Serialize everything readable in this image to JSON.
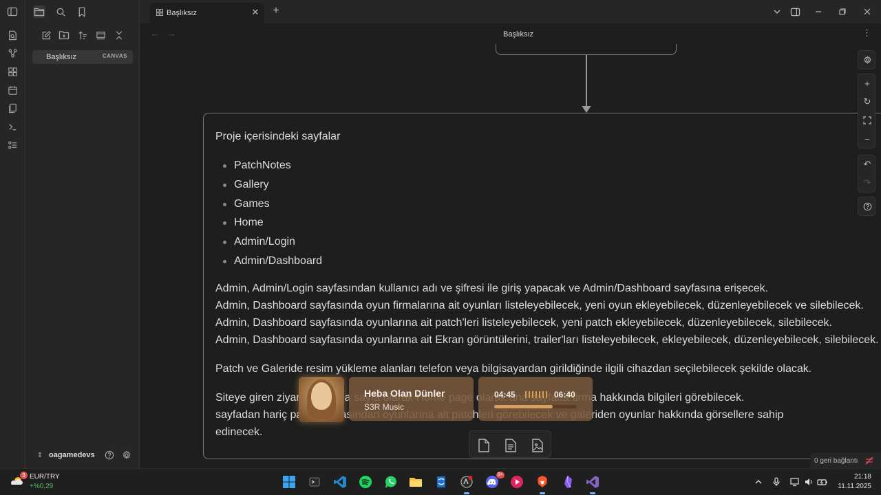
{
  "sidebar": {
    "file": {
      "name": "Başlıksız",
      "badge": "CANVAS"
    },
    "vault_name": "oagamedevs"
  },
  "tabs": [
    {
      "label": "Başlıksız"
    }
  ],
  "view": {
    "title": "Başlıksız"
  },
  "canvas": {
    "node": {
      "heading": "Proje içerisindeki sayfalar",
      "pages": [
        "PatchNotes",
        "Gallery",
        "Games",
        "Home",
        "Admin/Login",
        "Admin/Dashboard"
      ],
      "admin_lines": [
        "Admin, Admin/Login sayfasından kullanıcı adı ve şifresi ile giriş yapacak ve Admin/Dashboard sayfasına erişecek.",
        "Admin, Dashboard sayfasında oyun firmalarına ait oyunları listeleyebilecek, yeni oyun ekleyebilecek, düzenleyebilecek ve silebilecek.",
        "Admin, Dashboard sayfasında oyunlarına ait patch'leri listeleyebilecek, yeni patch ekleyebilecek, düzenleyebilecek, silebilecek.",
        "Admin, Dashboard sayfasında oyunlarına ait Ekran görüntülerini, trailer'ları listeleyebilecek, ekleyebilecek, düzenleyebilecek, silebilecek."
      ],
      "upload_line": "Patch ve Galeride resim yükleme alanları telefon veya bilgisayardan girildiğinde ilgili cihazdan seçilebilecek şekilde olacak.",
      "visitor_lines": [
        "Siteye giren ziyaretçiler ana sayfa olarak Home page olarak ana sayfada firma hakkında bilgileri görebilecek.",
        "sayfadan hariç patch sayfasından oyunlarına ait patchleri görebilecek ve galeriden oyunlar hakkında görsellere sahip",
        "edinecek."
      ]
    }
  },
  "status": {
    "sync": "0 geri bağlantı"
  },
  "music": {
    "title": "Heba Olan Dünler",
    "artist": "S3R Music",
    "elapsed": "04:45",
    "total": "06:40",
    "progress": 0.71
  },
  "taskbar": {
    "weather_badge": "3",
    "pair": "EUR/TRY",
    "change": "+%0,29",
    "time": "21:18",
    "date": "11.11.2025",
    "discord_badge": "9+"
  }
}
